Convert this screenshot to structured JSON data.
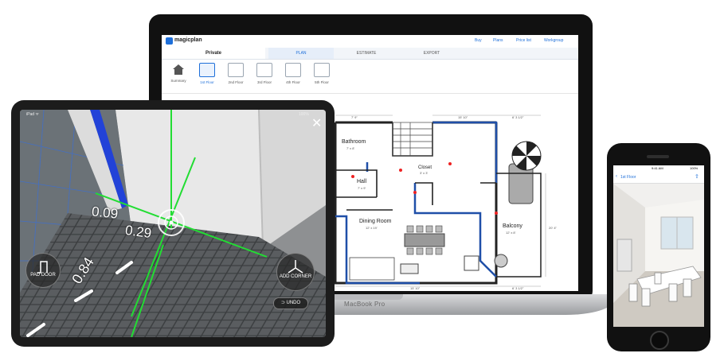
{
  "laptop": {
    "brand_label": "MacBook Pro",
    "app": {
      "logo_text": "magicplan",
      "nav": [
        "Buy",
        "Plans",
        "Price list",
        "Workgroup"
      ],
      "project_name": "Private",
      "tabs": [
        "PLAN",
        "ESTIMATE",
        "EXPORT"
      ],
      "active_tab": "PLAN",
      "floors": [
        "Summary",
        "1st Floor",
        "2nd Floor",
        "3rd Floor",
        "4th Floor",
        "5th Floor"
      ],
      "selected_floor": "1st Floor"
    },
    "floorplan": {
      "rooms": [
        {
          "name": "Bathroom",
          "size": "7' x 8'"
        },
        {
          "name": "Hall",
          "size": "7' x 9'"
        },
        {
          "name": "Closet",
          "size": "3' x 3'"
        },
        {
          "name": "Dining Room",
          "size": "12' x 19'"
        },
        {
          "name": "Balcony",
          "size": "12' x 8'"
        }
      ],
      "dimensions": {
        "top_left": "7' 9\"",
        "top_mid": "15' 10\"",
        "top_right": "6' 3 1/2\"",
        "right": "20' 4\"",
        "bottom_mid": "15' 10\"",
        "bottom_right": "6' 3 1/2\""
      }
    }
  },
  "tablet": {
    "measurements": [
      "0.09",
      "0.29",
      "0.84"
    ],
    "buttons": {
      "pad_door": "PAD DOOR",
      "add_corner": "ADD CORNER",
      "undo": "UNDO"
    },
    "status_left": "iPad ᯤ",
    "status_right": "100%"
  },
  "phone": {
    "back_label": "1st Floor",
    "status_time": "9:41 AM",
    "status_battery": "100%"
  },
  "colors": {
    "accent_blue": "#1e6fd9",
    "ar_green": "#22dd33",
    "plan_blue": "#1f4fa8"
  }
}
